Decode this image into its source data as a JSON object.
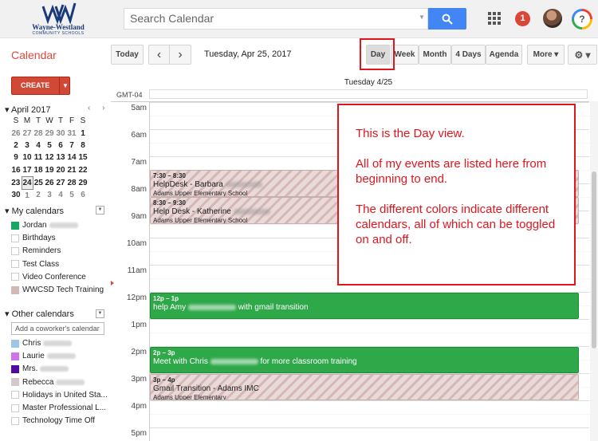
{
  "header": {
    "logo_name": "Wayne-Westland",
    "logo_sub": "COMMUNITY SCHOOLS",
    "search_placeholder": "Search Calendar",
    "notification_count": "1",
    "help_glyph": "?",
    "icons": [
      "search-icon",
      "apps-grid-icon",
      "notification-badge",
      "user-avatar",
      "help-icon"
    ]
  },
  "toolbar": {
    "app_title": "Calendar",
    "today_label": "Today",
    "prev_glyph": "‹",
    "next_glyph": "›",
    "date_label": "Tuesday, Apr 25, 2017",
    "views": [
      "Day",
      "Week",
      "Month",
      "4 Days",
      "Agenda"
    ],
    "active_view": "Day",
    "more_label": "More ▾",
    "settings_glyph": "⚙ ▾"
  },
  "sidebar": {
    "create_label": "CREATE",
    "mini_cal": {
      "title": "April 2017",
      "nav": "‹ ›",
      "dow": [
        "S",
        "M",
        "T",
        "W",
        "T",
        "F",
        "S"
      ],
      "weeks": [
        [
          "26",
          "27",
          "28",
          "29",
          "30",
          "31",
          "1"
        ],
        [
          "2",
          "3",
          "4",
          "5",
          "6",
          "7",
          "8"
        ],
        [
          "9",
          "10",
          "11",
          "12",
          "13",
          "14",
          "15"
        ],
        [
          "16",
          "17",
          "18",
          "19",
          "20",
          "21",
          "22"
        ],
        [
          "23",
          "24",
          "25",
          "26",
          "27",
          "28",
          "29"
        ],
        [
          "30",
          "1",
          "2",
          "3",
          "4",
          "5",
          "6"
        ]
      ],
      "today": "24"
    },
    "my_calendars": {
      "heading": "My calendars",
      "items": [
        {
          "label": "Jordan",
          "color": "#16a765",
          "blurred": true
        },
        {
          "label": "Birthdays",
          "color": "#ffffff",
          "blurred": false
        },
        {
          "label": "Reminders",
          "color": "#ffffff",
          "blurred": false
        },
        {
          "label": "Test Class",
          "color": "#ffffff",
          "blurred": false
        },
        {
          "label": "Video Conference",
          "color": "#ffffff",
          "blurred": false
        },
        {
          "label": "WWCSD Tech Training",
          "color": "#d5b8b6",
          "blurred": false
        }
      ]
    },
    "other_calendars": {
      "heading": "Other calendars",
      "coworker_placeholder": "Add a coworker's calendar",
      "items": [
        {
          "label": "Chris",
          "color": "#9fc6e7",
          "blurred": true
        },
        {
          "label": "Laurie",
          "color": "#cd74e6",
          "blurred": true
        },
        {
          "label": "Mrs.",
          "color": "#4e0b9c",
          "blurred": true
        },
        {
          "label": "Rebecca",
          "color": "#d5c8c8",
          "blurred": true
        },
        {
          "label": "Holidays in United Sta...",
          "color": "#ffffff",
          "blurred": false
        },
        {
          "label": "Master Professional L...",
          "color": "#ffffff",
          "blurred": false
        },
        {
          "label": "Technology Time Off",
          "color": "#ffffff",
          "blurred": false
        }
      ]
    }
  },
  "grid": {
    "timezone": "GMT-04",
    "column_header": "Tuesday 4/25",
    "hours": [
      "5am",
      "6am",
      "7am",
      "8am",
      "9am",
      "10am",
      "11am",
      "12pm",
      "1pm",
      "2pm",
      "3pm",
      "4pm",
      "5pm"
    ]
  },
  "events": [
    {
      "time": "7:30 – 8:30",
      "title": "HelpDesk - Barbara",
      "location": "Adams Upper Elementary School",
      "style": "pink"
    },
    {
      "time": "8:30 – 9:30",
      "title": "Help Desk - Katherine",
      "location": "Adams Upper Elementary School",
      "style": "pink"
    },
    {
      "time": "12p – 1p",
      "title_before": "help Amy",
      "title_after": "with gmail transition",
      "style": "green"
    },
    {
      "time": "2p – 3p",
      "title_before": "Meet with Chris",
      "title_after": "for more classroom training",
      "style": "green"
    },
    {
      "time": "3p – 4p",
      "title": "Gmail Transition - Adams IMC",
      "location": "Adams Upper Elementary",
      "style": "pink"
    }
  ],
  "callout": {
    "lines": [
      "This is the Day view.",
      "All of my events are listed here from beginning to end.",
      "The different colors indicate different calendars, all of which can be toggled on and off."
    ],
    "border_color": "#e0161e"
  }
}
